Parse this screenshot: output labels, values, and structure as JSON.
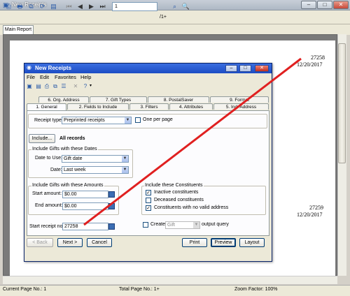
{
  "window": {
    "title": "New Receipts"
  },
  "toolbar": {
    "page_value": "1",
    "page_total": "/1+"
  },
  "tabs": {
    "main_report": "Main Report"
  },
  "report": {
    "entries": [
      {
        "number": "27258",
        "date": "12/20/2017"
      },
      {
        "number": "27259",
        "date": "12/20/2017"
      }
    ]
  },
  "status": {
    "current_page": "Current Page No.: 1",
    "total_page": "Total Page No.: 1+",
    "zoom": "Zoom Factor: 100%"
  },
  "dialog": {
    "title": "New Receipts",
    "menu": [
      "File",
      "Edit",
      "Favorites",
      "Help"
    ],
    "tabs_back": [
      "6. Org. Address",
      "7. Gift Types",
      "8. PostalSaver",
      "9. Format"
    ],
    "tabs_front": [
      "1. General",
      "2. Fields to Include",
      "3. Filters",
      "4. Attributes",
      "5. Ind. Address"
    ],
    "receipt_type_label": "Receipt type:",
    "receipt_type_value": "Preprinted receipts",
    "one_per_page": "One per page",
    "include_button": "Include...",
    "include_value": "All records",
    "gifts_dates_group": "Include Gifts with these Dates",
    "date_to_use_label": "Date to Use:",
    "date_to_use_value": "Gift date",
    "date_label": "Date:",
    "date_value": "Last week",
    "gifts_amounts_group": "Include Gifts with these Amounts",
    "start_amount_label": "Start amount:",
    "start_amount_value": "$0.00",
    "end_amount_label": "End amount:",
    "end_amount_value": "$0.00",
    "constituents_group": "Include these Constituents",
    "constituents": [
      {
        "label": "Inactive constituents",
        "checked": true
      },
      {
        "label": "Deceased constituents",
        "checked": false
      },
      {
        "label": "Constituents with no valid address",
        "checked": true
      }
    ],
    "start_receipt_label": "Start receipt no.:",
    "start_receipt_value": "27258",
    "create_label": "Create",
    "create_combo": "Gift",
    "output_query": "output query",
    "buttons": {
      "back": "< Back",
      "next": "Next >",
      "cancel": "Cancel",
      "print": "Print",
      "preview": "Preview",
      "layout": "Layout"
    }
  },
  "colors": {
    "annotation_line": "#e02020",
    "dialog_title": "#1c4cc4"
  }
}
